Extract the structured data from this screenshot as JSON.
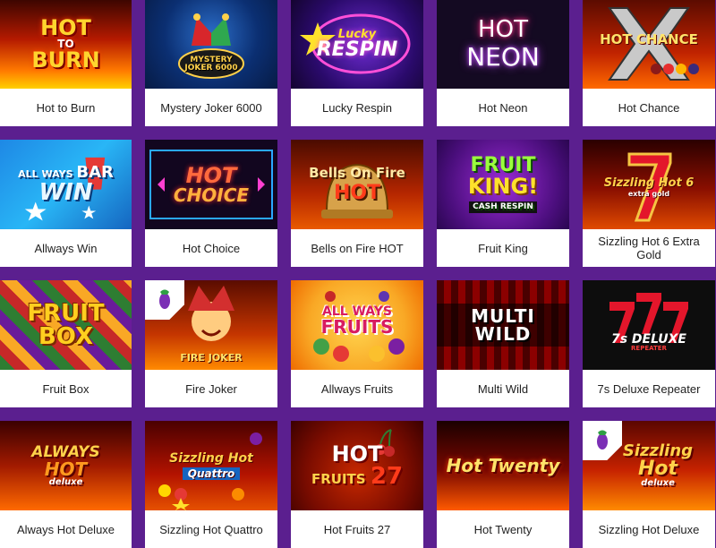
{
  "games": [
    {
      "title": "Hot to Burn"
    },
    {
      "title": "Mystery Joker 6000"
    },
    {
      "title": "Lucky Respin"
    },
    {
      "title": "Hot Neon"
    },
    {
      "title": "Hot Chance"
    },
    {
      "title": "Allways Win"
    },
    {
      "title": "Hot Choice"
    },
    {
      "title": "Bells on Fire HOT"
    },
    {
      "title": "Fruit King"
    },
    {
      "title": "Sizzling Hot 6 Extra Gold"
    },
    {
      "title": "Fruit Box"
    },
    {
      "title": "Fire Joker"
    },
    {
      "title": "Allways Fruits"
    },
    {
      "title": "Multi Wild"
    },
    {
      "title": "7s Deluxe Repeater"
    },
    {
      "title": "Always Hot Deluxe"
    },
    {
      "title": "Sizzling Hot Quattro"
    },
    {
      "title": "Hot Fruits 27"
    },
    {
      "title": "Hot Twenty"
    },
    {
      "title": "Sizzling Hot Deluxe"
    }
  ],
  "logos": {
    "hot_to_burn": [
      "HOT",
      "TO",
      "BURN"
    ],
    "mystery_joker": "MYSTERY JOKER 6000",
    "lucky_respin": [
      "Lucky",
      "RESPIN"
    ],
    "hot_neon": [
      "HOT",
      "NEON"
    ],
    "hot_chance": "HOT CHANCE",
    "allways_win": [
      "ALL",
      "WAYS",
      "BAR",
      "WIN"
    ],
    "hot_choice": [
      "HOT",
      "CHOICE"
    ],
    "bells_on_fire": [
      "Bells On Fire",
      "HOT"
    ],
    "fruit_king": [
      "FRUIT",
      "KING!",
      "CASH RESPIN"
    ],
    "sizzling_6": [
      "Sizzling Hot 6",
      "extra gold"
    ],
    "fruit_box": [
      "FRUIT",
      "BOX"
    ],
    "fire_joker": "FIRE JOKER",
    "allways_fruits": [
      "ALL WAYS",
      "FRUITS"
    ],
    "multi_wild": "MULTI WILD",
    "seven_deluxe": [
      "7s DELUXE",
      "REPEATER"
    ],
    "always_hot": [
      "ALWAYS",
      "HOT",
      "deluxe"
    ],
    "sizzling_quattro": [
      "Sizzling Hot",
      "Quattro"
    ],
    "hot_fruits_27": [
      "HOT",
      "FRUITS",
      "27"
    ],
    "hot_twenty": "Hot Twenty",
    "sizzling_deluxe": [
      "Sizzling",
      "Hot",
      "deluxe"
    ]
  },
  "colors": {
    "page_bg": "#5b1f8f",
    "card_bg": "#ffffff",
    "label_text": "#222222",
    "badge_icon": "#7b2fb5"
  },
  "icons": {
    "badge": "eggplant-icon"
  }
}
